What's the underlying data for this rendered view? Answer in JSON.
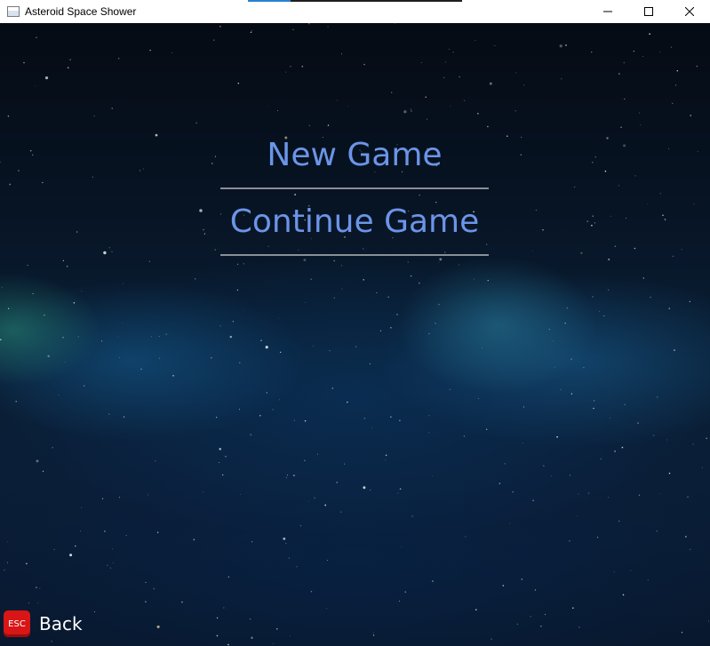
{
  "window": {
    "title": "Asteroid Space Shower",
    "icon": "application-icon",
    "controls": [
      "minimize-icon",
      "maximize-icon",
      "close-icon"
    ]
  },
  "menu": {
    "items": [
      {
        "label": "New Game"
      },
      {
        "label": "Continue Game"
      }
    ],
    "text_color": "#6c94e8",
    "divider_color": "#8a8f96"
  },
  "back": {
    "key_label": "ESC",
    "label": "Back",
    "key_color": "#d81616"
  }
}
